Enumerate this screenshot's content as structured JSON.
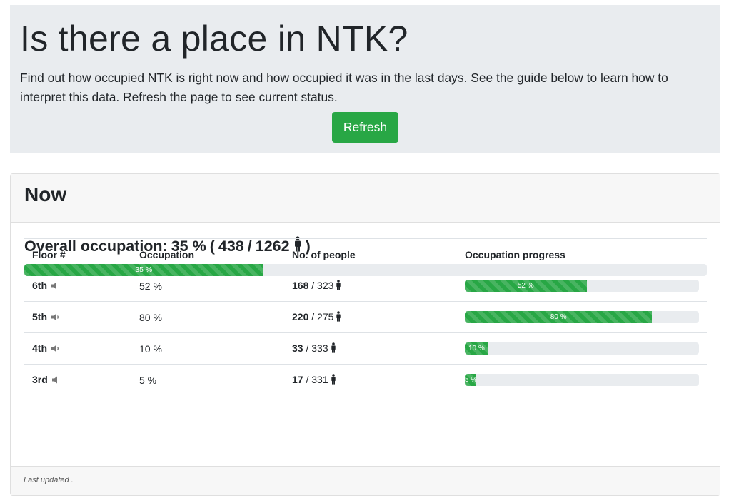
{
  "header": {
    "title": "Is there a place in NTK?",
    "description": "Find out how occupied NTK is right now and how occupied it was in the last days. See the guide below to learn how to interpret this data. Refresh the page to see current status.",
    "refresh_label": "Refresh"
  },
  "now": {
    "title": "Now",
    "overall_label": "Overall occupation:",
    "overall_percent_text": "35 %",
    "overall_open": "(",
    "overall_people": "438",
    "overall_sep": "/",
    "overall_capacity": "1262",
    "overall_close": ")",
    "overall_progress": 35,
    "overall_bar_label": "35 %",
    "columns": [
      "Floor #",
      "Occupation",
      "No. of people",
      "Occupation progress"
    ],
    "floors": [
      {
        "floor": "6th",
        "occupation": "52 %",
        "people": "168",
        "capacity": "/ 323",
        "progress": 52,
        "bar_label": "52 %",
        "speaker": "speaker-low-icon"
      },
      {
        "floor": "5th",
        "occupation": "80 %",
        "people": "220",
        "capacity": "/ 275",
        "progress": 80,
        "bar_label": "80 %",
        "speaker": "speaker-high-icon"
      },
      {
        "floor": "4th",
        "occupation": "10 %",
        "people": "33",
        "capacity": "/ 333",
        "progress": 10,
        "bar_label": "10 %",
        "speaker": "speaker-high-icon"
      },
      {
        "floor": "3rd",
        "occupation": "5 %",
        "people": "17",
        "capacity": "/ 331",
        "progress": 5,
        "bar_label": "5 %",
        "speaker": "speaker-low-icon"
      }
    ],
    "footer": "Last updated ."
  },
  "colors": {
    "accent": "#28a745",
    "jumbotron_bg": "#e9ecef"
  }
}
